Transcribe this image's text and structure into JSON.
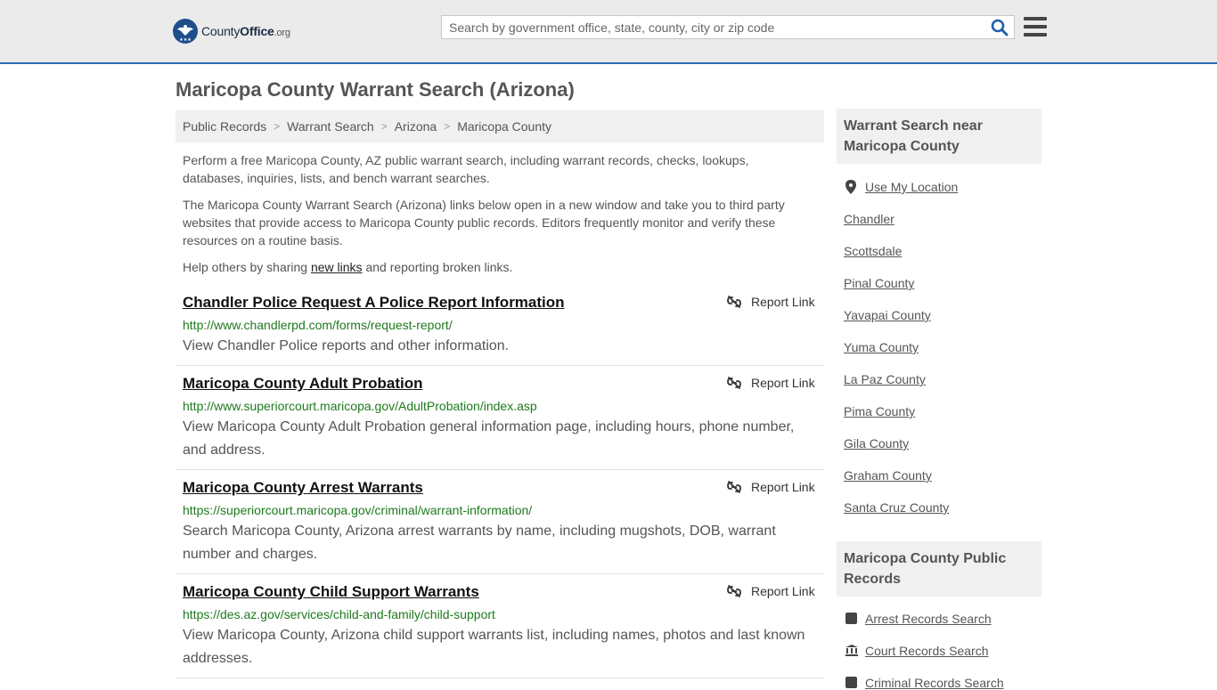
{
  "header": {
    "logo_county": "County",
    "logo_office": "Office",
    "logo_org": ".org",
    "search_placeholder": "Search by government office, state, county, city or zip code"
  },
  "page": {
    "title": "Maricopa County Warrant Search (Arizona)",
    "breadcrumb": [
      "Public Records",
      "Warrant Search",
      "Arizona",
      "Maricopa County"
    ],
    "intro1": "Perform a free Maricopa County, AZ public warrant search, including warrant records, checks, lookups, databases, inquiries, lists, and bench warrant searches.",
    "intro2": "The Maricopa County Warrant Search (Arizona) links below open in a new window and take you to third party websites that provide access to Maricopa County public records. Editors frequently monitor and verify these resources on a routine basis.",
    "help_prefix": "Help others by sharing ",
    "help_link": "new links",
    "help_suffix": " and reporting broken links."
  },
  "results": [
    {
      "title": "Chandler Police Request A Police Report Information",
      "url": "http://www.chandlerpd.com/forms/request-report/",
      "desc": "View Chandler Police reports and other information.",
      "report": "Report Link"
    },
    {
      "title": "Maricopa County Adult Probation",
      "url": "http://www.superiorcourt.maricopa.gov/AdultProbation/index.asp",
      "desc": "View Maricopa County Adult Probation general information page, including hours, phone number, and address.",
      "report": "Report Link"
    },
    {
      "title": "Maricopa County Arrest Warrants",
      "url": "https://superiorcourt.maricopa.gov/criminal/warrant-information/",
      "desc": "Search Maricopa County, Arizona arrest warrants by name, including mugshots, DOB, warrant number and charges.",
      "report": "Report Link"
    },
    {
      "title": "Maricopa County Child Support Warrants",
      "url": "https://des.az.gov/services/child-and-family/child-support",
      "desc": "View Maricopa County, Arizona child support warrants list, including names, photos and last known addresses.",
      "report": "Report Link"
    }
  ],
  "sidebar": {
    "near_title": "Warrant Search near Maricopa County",
    "use_location": "Use My Location",
    "near_links": [
      "Chandler",
      "Scottsdale",
      "Pinal County",
      "Yavapai County",
      "Yuma County",
      "La Paz County",
      "Pima County",
      "Gila County",
      "Graham County",
      "Santa Cruz County"
    ],
    "records_title": "Maricopa County Public Records",
    "records_links": [
      "Arrest Records Search",
      "Court Records Search",
      "Criminal Records Search"
    ]
  },
  "colors": {
    "accent": "#2b6cb0",
    "url_green": "#1e7a1e",
    "logo_navy": "#1a2b45"
  }
}
